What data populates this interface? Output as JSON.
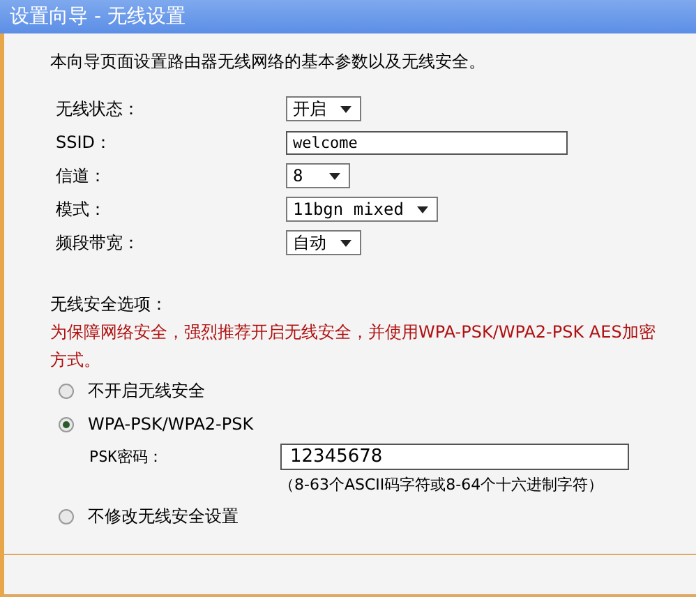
{
  "window": {
    "title": "设置向导 - 无线设置"
  },
  "intro": "本向导页面设置路由器无线网络的基本参数以及无线安全。",
  "fields": [
    {
      "label": "无线状态：",
      "kind": "select",
      "value": "开启"
    },
    {
      "label": "SSID：",
      "kind": "text",
      "value": "welcome"
    },
    {
      "label": "信道：",
      "kind": "select",
      "value": "8"
    },
    {
      "label": "模式：",
      "kind": "select",
      "value": "11bgn mixed"
    },
    {
      "label": "频段带宽：",
      "kind": "select",
      "value": "自动"
    }
  ],
  "security": {
    "heading": "无线安全选项：",
    "warning": "为保障网络安全，强烈推荐开启无线安全，并使用WPA-PSK/WPA2-PSK AES加密方式。",
    "options": [
      {
        "label": "不开启无线安全",
        "selected": false
      },
      {
        "label": "WPA-PSK/WPA2-PSK",
        "selected": true,
        "psk_label": "PSK密码：",
        "psk_value": "12345678",
        "psk_hint": "（8-63个ASCII码字符或8-64个十六进制字符）"
      },
      {
        "label": "不修改无线安全设置",
        "selected": false
      }
    ]
  }
}
